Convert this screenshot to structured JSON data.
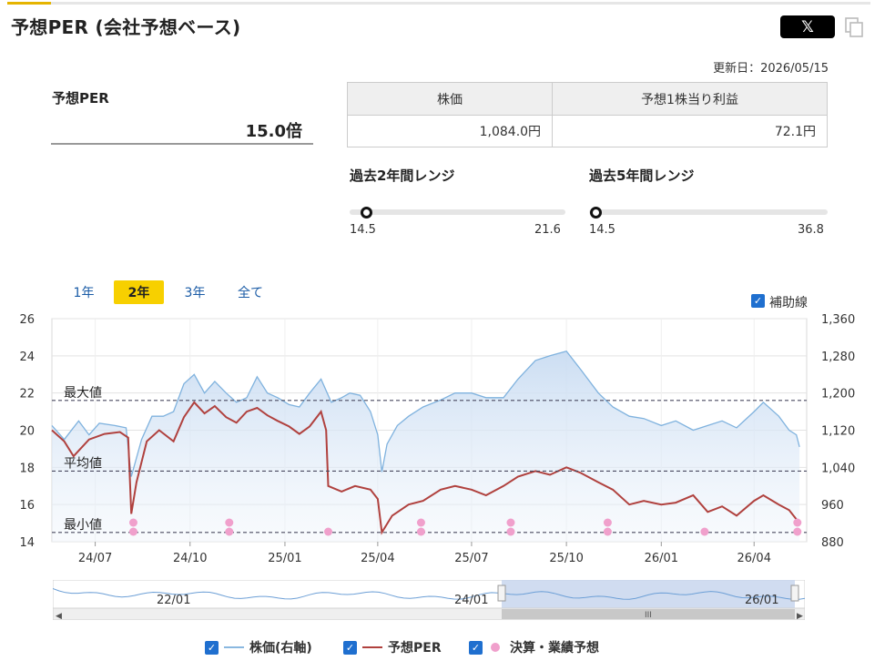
{
  "page": {
    "title": "予想PER (会社予想ベース)"
  },
  "share": {
    "x_label": "𝕏"
  },
  "updated": "更新日：2026/05/15",
  "per": {
    "label": "予想PER",
    "value": "15.0倍"
  },
  "price_table": {
    "headers": [
      "株価",
      "予想1株当り利益"
    ],
    "values": [
      "1,084.0円",
      "72.1円"
    ]
  },
  "ranges": [
    {
      "title": "過去2年間レンジ",
      "min": "14.5",
      "max": "21.6",
      "current": 15.0,
      "low": 14.5,
      "high": 21.6
    },
    {
      "title": "過去5年間レンジ",
      "min": "14.5",
      "max": "36.8",
      "current": 15.0,
      "low": 14.5,
      "high": 36.8
    }
  ],
  "period_tabs": [
    {
      "label": "1年",
      "active": false
    },
    {
      "label": "2年",
      "active": true
    },
    {
      "label": "3年",
      "active": false
    },
    {
      "label": "全て",
      "active": false
    }
  ],
  "aux_lines": {
    "label": "補助線",
    "checked": true
  },
  "legend": [
    {
      "label": "株価(右軸)",
      "color": "#8ab8e0",
      "type": "line"
    },
    {
      "label": "予想PER",
      "color": "#b0413e",
      "type": "line"
    },
    {
      "label": "決算・業績予想",
      "color": "#f0a0cc",
      "type": "dot"
    }
  ],
  "colors": {
    "price_line": "#7fb2de",
    "price_fill_top": "#c9dcf2",
    "per_line": "#b0413e",
    "event_dot": "#f0a0cc",
    "ref_line": "#4a4a60",
    "active_tab": "#f7d000"
  },
  "chart_data": {
    "type": "line",
    "x_tick_labels": [
      "24/07",
      "24/10",
      "25/01",
      "25/04",
      "25/07",
      "25/10",
      "26/01",
      "26/04"
    ],
    "navigator_labels": [
      "22/01",
      "24/01",
      "26/01"
    ],
    "left_axis": {
      "label": "",
      "ylim": [
        14,
        26
      ],
      "ticks": [
        14,
        16,
        18,
        20,
        22,
        24,
        26
      ]
    },
    "right_axis": {
      "label": "",
      "ylim": [
        880,
        1360
      ],
      "ticks": [
        "880",
        "960",
        "1,040",
        "1,120",
        "1,200",
        "1,280",
        "1,360"
      ]
    },
    "reference_lines": [
      {
        "label": "最大値",
        "value": 21.6
      },
      {
        "label": "平均値",
        "value": 17.8
      },
      {
        "label": "最小値",
        "value": 14.5
      }
    ],
    "series": [
      {
        "name": "株価(右軸)",
        "axis": "right",
        "points": [
          [
            "2024-05-20",
            1130
          ],
          [
            "2024-06-01",
            1100
          ],
          [
            "2024-06-15",
            1140
          ],
          [
            "2024-06-25",
            1110
          ],
          [
            "2024-07-05",
            1135
          ],
          [
            "2024-07-20",
            1130
          ],
          [
            "2024-07-31",
            1125
          ],
          [
            "2024-08-05",
            1020
          ],
          [
            "2024-08-15",
            1100
          ],
          [
            "2024-08-25",
            1150
          ],
          [
            "2024-09-05",
            1150
          ],
          [
            "2024-09-15",
            1160
          ],
          [
            "2024-09-25",
            1220
          ],
          [
            "2024-10-05",
            1240
          ],
          [
            "2024-10-15",
            1200
          ],
          [
            "2024-10-25",
            1225
          ],
          [
            "2024-11-05",
            1200
          ],
          [
            "2024-11-15",
            1180
          ],
          [
            "2024-11-25",
            1190
          ],
          [
            "2024-12-05",
            1235
          ],
          [
            "2024-12-15",
            1200
          ],
          [
            "2024-12-25",
            1190
          ],
          [
            "2025-01-05",
            1175
          ],
          [
            "2025-01-15",
            1170
          ],
          [
            "2025-01-25",
            1200
          ],
          [
            "2025-02-05",
            1230
          ],
          [
            "2025-02-15",
            1180
          ],
          [
            "2025-02-25",
            1190
          ],
          [
            "2025-03-05",
            1200
          ],
          [
            "2025-03-15",
            1195
          ],
          [
            "2025-03-25",
            1160
          ],
          [
            "2025-04-01",
            1110
          ],
          [
            "2025-04-05",
            1030
          ],
          [
            "2025-04-10",
            1090
          ],
          [
            "2025-04-20",
            1130
          ],
          [
            "2025-05-01",
            1150
          ],
          [
            "2025-05-15",
            1170
          ],
          [
            "2025-06-01",
            1185
          ],
          [
            "2025-06-15",
            1200
          ],
          [
            "2025-07-01",
            1200
          ],
          [
            "2025-07-15",
            1190
          ],
          [
            "2025-08-01",
            1190
          ],
          [
            "2025-08-15",
            1230
          ],
          [
            "2025-09-01",
            1270
          ],
          [
            "2025-09-15",
            1280
          ],
          [
            "2025-10-01",
            1290
          ],
          [
            "2025-10-15",
            1250
          ],
          [
            "2025-11-01",
            1200
          ],
          [
            "2025-11-15",
            1170
          ],
          [
            "2025-12-01",
            1150
          ],
          [
            "2025-12-15",
            1145
          ],
          [
            "2026-01-01",
            1130
          ],
          [
            "2026-01-15",
            1140
          ],
          [
            "2026-02-01",
            1120
          ],
          [
            "2026-02-15",
            1130
          ],
          [
            "2026-03-01",
            1140
          ],
          [
            "2026-03-15",
            1125
          ],
          [
            "2026-04-01",
            1160
          ],
          [
            "2026-04-10",
            1180
          ],
          [
            "2026-04-25",
            1150
          ],
          [
            "2026-05-05",
            1120
          ],
          [
            "2026-05-12",
            1110
          ],
          [
            "2026-05-15",
            1084
          ]
        ]
      },
      {
        "name": "予想PER",
        "axis": "left",
        "points": [
          [
            "2024-05-20",
            20.0
          ],
          [
            "2024-06-01",
            19.4
          ],
          [
            "2024-06-10",
            18.6
          ],
          [
            "2024-06-25",
            19.5
          ],
          [
            "2024-07-10",
            19.8
          ],
          [
            "2024-07-25",
            19.9
          ],
          [
            "2024-08-02",
            19.6
          ],
          [
            "2024-08-05",
            15.5
          ],
          [
            "2024-08-10",
            17.2
          ],
          [
            "2024-08-20",
            19.4
          ],
          [
            "2024-09-01",
            20.0
          ],
          [
            "2024-09-15",
            19.4
          ],
          [
            "2024-09-25",
            20.7
          ],
          [
            "2024-10-05",
            21.5
          ],
          [
            "2024-10-15",
            20.9
          ],
          [
            "2024-10-25",
            21.3
          ],
          [
            "2024-11-05",
            20.7
          ],
          [
            "2024-11-15",
            20.4
          ],
          [
            "2024-11-25",
            21.0
          ],
          [
            "2024-12-05",
            21.2
          ],
          [
            "2024-12-15",
            20.8
          ],
          [
            "2024-12-25",
            20.5
          ],
          [
            "2025-01-05",
            20.2
          ],
          [
            "2025-01-15",
            19.8
          ],
          [
            "2025-01-25",
            20.2
          ],
          [
            "2025-02-05",
            21.0
          ],
          [
            "2025-02-10",
            20.0
          ],
          [
            "2025-02-12",
            17.0
          ],
          [
            "2025-02-25",
            16.7
          ],
          [
            "2025-03-10",
            17.0
          ],
          [
            "2025-03-25",
            16.8
          ],
          [
            "2025-04-01",
            16.3
          ],
          [
            "2025-04-05",
            14.5
          ],
          [
            "2025-04-15",
            15.4
          ],
          [
            "2025-05-01",
            16.0
          ],
          [
            "2025-05-15",
            16.2
          ],
          [
            "2025-06-01",
            16.8
          ],
          [
            "2025-06-15",
            17.0
          ],
          [
            "2025-07-01",
            16.8
          ],
          [
            "2025-07-15",
            16.5
          ],
          [
            "2025-08-01",
            17.0
          ],
          [
            "2025-08-15",
            17.5
          ],
          [
            "2025-09-01",
            17.8
          ],
          [
            "2025-09-15",
            17.6
          ],
          [
            "2025-10-01",
            18.0
          ],
          [
            "2025-10-15",
            17.7
          ],
          [
            "2025-11-01",
            17.2
          ],
          [
            "2025-11-15",
            16.8
          ],
          [
            "2025-12-01",
            16.0
          ],
          [
            "2025-12-15",
            16.2
          ],
          [
            "2026-01-01",
            16.0
          ],
          [
            "2026-01-15",
            16.1
          ],
          [
            "2026-02-01",
            16.5
          ],
          [
            "2026-02-15",
            15.6
          ],
          [
            "2026-03-01",
            15.9
          ],
          [
            "2026-03-15",
            15.4
          ],
          [
            "2026-04-01",
            16.2
          ],
          [
            "2026-04-10",
            16.5
          ],
          [
            "2026-04-25",
            16.0
          ],
          [
            "2026-05-05",
            15.7
          ],
          [
            "2026-05-15",
            15.0
          ]
        ]
      }
    ],
    "events": [
      {
        "date": "2024-08-07",
        "markers": 2
      },
      {
        "date": "2024-11-08",
        "markers": 2
      },
      {
        "date": "2025-02-12",
        "markers": 1
      },
      {
        "date": "2025-05-13",
        "markers": 2
      },
      {
        "date": "2025-08-08",
        "markers": 2
      },
      {
        "date": "2025-11-10",
        "markers": 2
      },
      {
        "date": "2026-02-12",
        "markers": 1
      },
      {
        "date": "2026-05-13",
        "markers": 2
      }
    ]
  }
}
